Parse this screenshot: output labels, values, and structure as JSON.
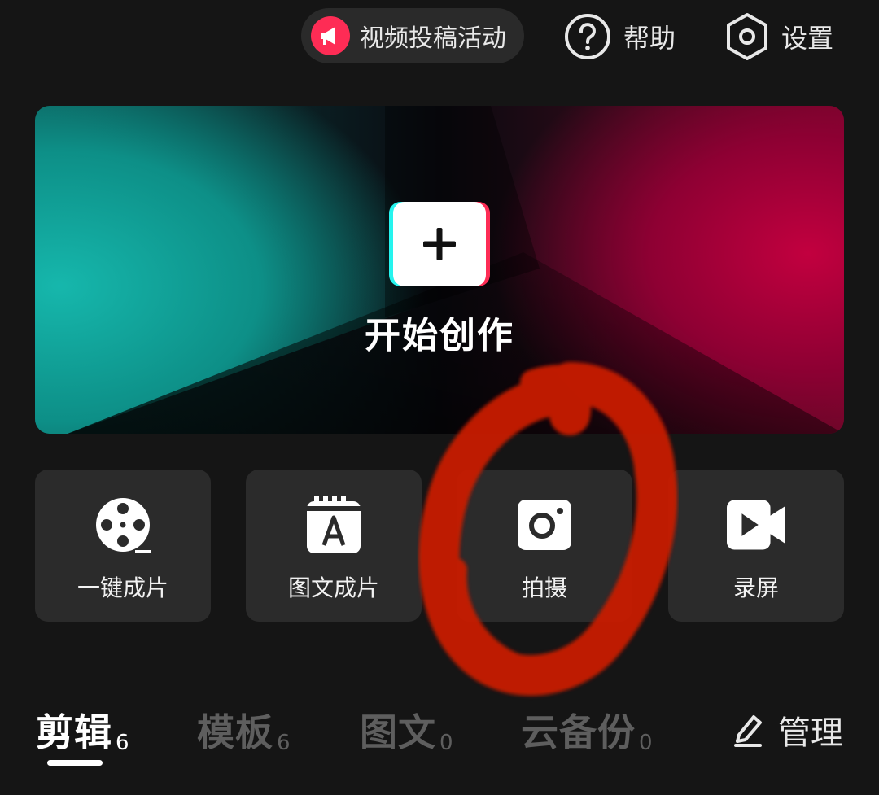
{
  "header": {
    "campaign_label": "视频投稿活动",
    "help_label": "帮助",
    "settings_label": "设置"
  },
  "hero": {
    "create_label": "开始创作"
  },
  "tools": [
    {
      "label": "一键成片",
      "icon": "film-reel-icon"
    },
    {
      "label": "图文成片",
      "icon": "text-image-icon"
    },
    {
      "label": "拍摄",
      "icon": "camera-icon"
    },
    {
      "label": "录屏",
      "icon": "video-record-icon"
    }
  ],
  "tabs": [
    {
      "label": "剪辑",
      "count": "6",
      "active": true
    },
    {
      "label": "模板",
      "count": "6",
      "active": false
    },
    {
      "label": "图文",
      "count": "0",
      "active": false
    },
    {
      "label": "云备份",
      "count": "0",
      "active": false
    }
  ],
  "manage": {
    "label": "管理"
  },
  "colors": {
    "background": "#151515",
    "accent_cyan": "#25f4ee",
    "accent_red": "#fe2c55",
    "annotation_red": "#c81e00"
  }
}
